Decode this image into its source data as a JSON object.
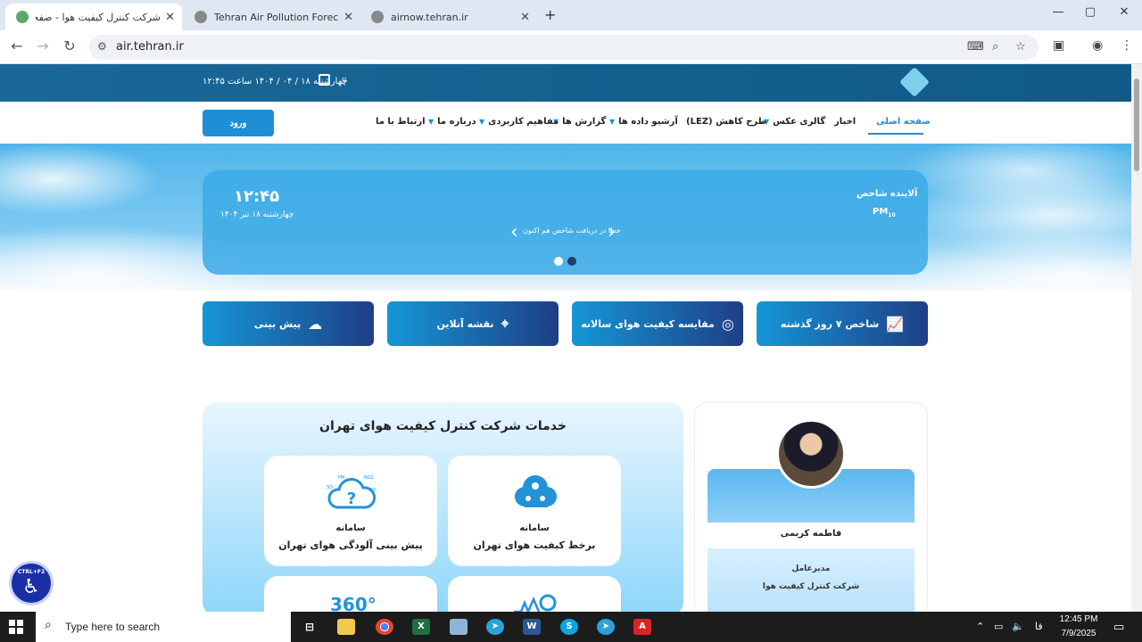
{
  "browser": {
    "tabs": [
      {
        "title": "شرکت کنترل کیفیت هوا - صفحه اصلی",
        "active": true
      },
      {
        "title": "Tehran Air Pollution Forecasting",
        "active": false
      },
      {
        "title": "airnow.tehran.ir",
        "active": false
      }
    ],
    "new_tab": "+",
    "close": "✕",
    "url": "air.tehran.ir"
  },
  "header": {
    "date_time": "چهارشنبه ۱۸ / ۰۴ / ۱۴۰۴ ساعت ۱۲:۴۵"
  },
  "nav": {
    "login_label": "ورود",
    "items": [
      {
        "label": "صفحه اصلی",
        "dropdown": false,
        "active": true
      },
      {
        "label": "اخبار",
        "dropdown": false
      },
      {
        "label": "گالری عکس",
        "dropdown": true
      },
      {
        "label": "طرح کاهش (LEZ)",
        "dropdown": false
      },
      {
        "label": "آرشیو داده ها",
        "dropdown": true
      },
      {
        "label": "گزارش ها",
        "dropdown": true
      },
      {
        "label": "مفاهیم کاربردی",
        "dropdown": true
      },
      {
        "label": "درباره ما",
        "dropdown": true
      },
      {
        "label": "ارتباط با ما",
        "dropdown": false
      }
    ]
  },
  "aqi": {
    "time": "۱۲:۴۵",
    "date": "چهارشنبه ۱۸ تیر ۱۴۰۴",
    "title": "آلاینده شاخص",
    "pollutant": "PM",
    "pollutant_sub": "10",
    "message": "خطا در دریافت شاخص هم اکنون",
    "slide_index": 1,
    "slide_count": 2
  },
  "features": [
    {
      "label": "شاخص ۷ روز گذشته",
      "icon": "line-chart-icon"
    },
    {
      "label": "مقایسه کیفیت هوای سالانه",
      "icon": "compare-icon"
    },
    {
      "label": "نقشه آنلاین",
      "icon": "map-icon"
    },
    {
      "label": "پیش بینی",
      "icon": "cloud-upload-icon"
    }
  ],
  "services": {
    "title": "خدمات شرکت کنترل کیفیت هوای تهران",
    "items": [
      {
        "line1": "سامانه",
        "line2": "برخط کیفیت هوای تهران",
        "icon": "cloud-network-icon"
      },
      {
        "line1": "سامانه",
        "line2": "پیش بینی آلودگی هوای تهران",
        "icon": "cloud-question-icon"
      },
      {
        "line1": "",
        "line2": "",
        "icon": "sensor-icon"
      },
      {
        "line1": "",
        "line2": "",
        "icon": "360-icon",
        "badge": "360°"
      }
    ],
    "pollutant_tags": [
      "PM",
      "NO2",
      "SO",
      "O3"
    ]
  },
  "profile": {
    "name": "فاطمه کریمی",
    "role": "مدیرعامل",
    "org": "شرکت کنترل کیفیت هوا"
  },
  "a11y": {
    "shortcut": "CTRL+F2"
  },
  "taskbar": {
    "search_placeholder": "Type here to search",
    "lang": "فا",
    "time": "12:45 PM",
    "date": "7/9/2025",
    "apps": [
      "task-view",
      "file-explorer",
      "chrome",
      "excel",
      "notepad",
      "telegram",
      "word",
      "skype",
      "telegram-alt",
      "acrobat"
    ]
  },
  "colors": {
    "accent": "#1e8fd6",
    "header": "#1a6898",
    "feature_start": "#1596d6",
    "feature_end": "#1e3f86"
  }
}
